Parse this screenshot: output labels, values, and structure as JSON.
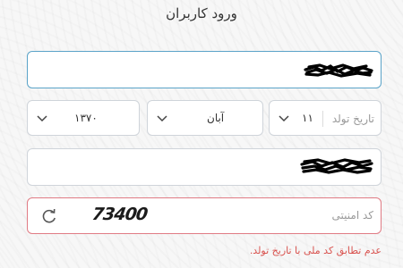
{
  "page": {
    "title": "ورود کاربران"
  },
  "fields": {
    "national_id": {
      "value_state": "redacted-scribble"
    },
    "birth_date": {
      "label": "تاریخ تولد",
      "day": "۱۱",
      "month": "آبان",
      "year": "۱۳۷۰"
    },
    "password": {
      "value_state": "redacted-scribble"
    },
    "captcha": {
      "code": "73400",
      "placeholder": "کد امنیتی",
      "refresh_icon": "refresh-icon"
    }
  },
  "error": {
    "message": "عدم تطابق کد ملی با تاریخ تولد."
  },
  "colors": {
    "focus_border": "#5aa3c8",
    "error_border": "#e07b84",
    "error_text": "#d9534f"
  }
}
